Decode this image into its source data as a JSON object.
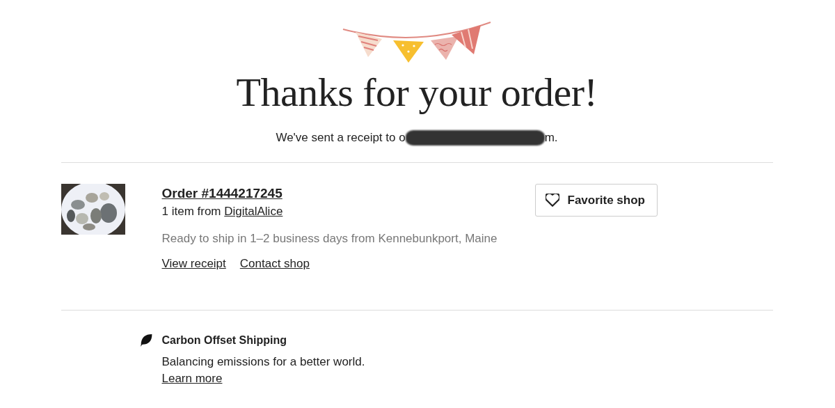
{
  "header": {
    "title": "Thanks for your order!",
    "receipt_text": "We've sent a receipt to o",
    "receipt_suffix": "m."
  },
  "order": {
    "title": "Order #1444217245",
    "items_text": "1 item from ",
    "shop_link": "DigitalAlice",
    "ship_text": "Ready to ship in 1–2 business days from Kennebunkport, Maine",
    "links": [
      "View receipt",
      "Contact shop"
    ],
    "favorite_button": "Favorite shop"
  },
  "carbon": {
    "title": "Carbon Offset Shipping",
    "text": "Balancing emissions for a better world.",
    "link": "Learn more"
  }
}
